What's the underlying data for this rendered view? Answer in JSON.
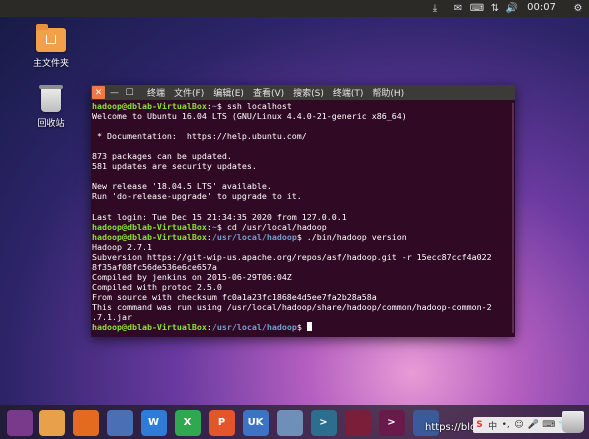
{
  "top_panel": {
    "clock": "00:07",
    "indicators": [
      "download-icon",
      "mail-icon",
      "keyboard-icon",
      "network-icon",
      "volume-icon",
      "power-icon"
    ]
  },
  "desktop": {
    "home_folder_label": "主文件夹",
    "trash_label": "回收站"
  },
  "terminal": {
    "menu": [
      "终端",
      "文件(F)",
      "编辑(E)",
      "查看(V)",
      "搜索(S)",
      "终端(T)",
      "帮助(H)"
    ],
    "lines": [
      {
        "user": "hadoop@dblab-VirtualBox",
        "path": "~",
        "cmd": " ssh localhost"
      },
      {
        "text": "Welcome to Ubuntu 16.04 LTS (GNU/Linux 4.4.0-21-generic x86_64)"
      },
      {
        "text": ""
      },
      {
        "text": " * Documentation:  https://help.ubuntu.com/"
      },
      {
        "text": ""
      },
      {
        "text": "873 packages can be updated."
      },
      {
        "text": "581 updates are security updates."
      },
      {
        "text": ""
      },
      {
        "text": "New release '18.04.5 LTS' available."
      },
      {
        "text": "Run 'do-release-upgrade' to upgrade to it."
      },
      {
        "text": ""
      },
      {
        "text": "Last login: Tue Dec 15 21:34:35 2020 from 127.0.0.1"
      },
      {
        "user": "hadoop@dblab-VirtualBox",
        "path": "~",
        "cmd": " cd /usr/local/hadoop"
      },
      {
        "user": "hadoop@dblab-VirtualBox",
        "path": "/usr/local/hadoop",
        "cmd": " ./bin/hadoop version"
      },
      {
        "text": "Hadoop 2.7.1"
      },
      {
        "text": "Subversion https://git-wip-us.apache.org/repos/asf/hadoop.git -r 15ecc87ccf4a022"
      },
      {
        "text": "8f35af08fc56de536e6ce657a"
      },
      {
        "text": "Compiled by jenkins on 2015-06-29T06:04Z"
      },
      {
        "text": "Compiled with protoc 2.5.0"
      },
      {
        "text": "From source with checksum fc0a1a23fc1868e4d5ee7fa2b28a58a"
      },
      {
        "text": "This command was run using /usr/local/hadoop/share/hadoop/common/hadoop-common-2"
      },
      {
        "text": ".7.1.jar"
      },
      {
        "user": "hadoop@dblab-VirtualBox",
        "path": "/usr/local/hadoop",
        "cmd": " ",
        "cursor": true
      }
    ]
  },
  "launcher": {
    "apps": [
      {
        "name": "ubuntu-dash-icon",
        "color": "#7a3a8c"
      },
      {
        "name": "files-icon",
        "color": "#e8a14a"
      },
      {
        "name": "firefox-icon",
        "color": "#e36b1f"
      },
      {
        "name": "chromium-icon",
        "color": "#4a6fb5"
      },
      {
        "name": "wps-writer-icon",
        "color": "#2e7bd8",
        "glyph": "W"
      },
      {
        "name": "wps-spreadsheet-icon",
        "color": "#2fa84f",
        "glyph": "X"
      },
      {
        "name": "wps-presentation-icon",
        "color": "#e4552b",
        "glyph": "P"
      },
      {
        "name": "uk-shop-icon",
        "color": "#3e72c4",
        "glyph": "UK"
      },
      {
        "name": "installer-icon",
        "color": "#6d8fb8"
      },
      {
        "name": "terminal-app-icon",
        "color": "#2b6e8e",
        "glyph": ">"
      },
      {
        "name": "record-icon",
        "color": "#7a1e3a"
      },
      {
        "name": "terminal-2-icon",
        "color": "#6a1a4a",
        "glyph": ">"
      },
      {
        "name": "workspace-icon",
        "color": "#3a5a9a"
      }
    ],
    "watermark": "https://blog"
  }
}
